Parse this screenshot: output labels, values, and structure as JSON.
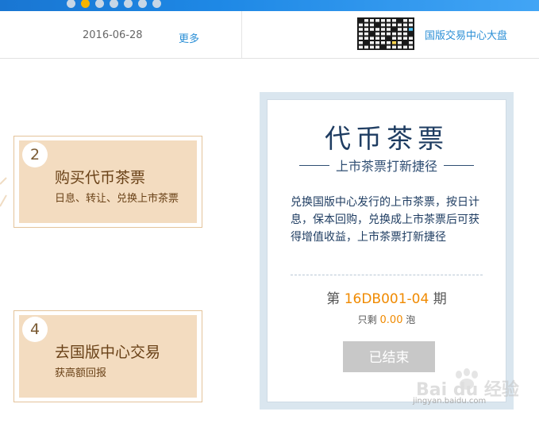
{
  "header": {
    "date": "2016-06-28",
    "more_label": "更多",
    "board_link": "国版交易中心大盘",
    "board_icon": "market-board-icon"
  },
  "carousel": {
    "dot_count": 7,
    "active_index": 1
  },
  "steps": [
    {
      "num": "2",
      "title": "购买代币茶票",
      "sub": "日息、转让、兑换上市茶票"
    },
    {
      "num": "4",
      "title": "去国版中心交易",
      "sub": "获高额回报"
    }
  ],
  "card": {
    "title": "代币茶票",
    "subtitle": "上市茶票打新捷径",
    "description": "兑换国版中心发行的上市茶票，按日计息，保本回购，兑换成上市茶票后可获得增值收益，上市茶票打新捷径",
    "period_prefix": "第",
    "period_code": "16DB001-04",
    "period_suffix": "期",
    "remain_prefix": "只剩",
    "remain_amount": "0.00",
    "remain_unit": "泡",
    "button_label": "已结束"
  },
  "watermark": {
    "logo": "Bai du 经验",
    "url": "jingyan.baidu.com"
  },
  "colors": {
    "banner": "#1e88e5",
    "accent_blue": "#2b8fd6",
    "dot_active": "#f5b400",
    "step_fill": "#f3dcc0",
    "card_navy": "#1f3d62",
    "highlight_orange": "#f08a00",
    "button_disabled": "#c8c8c8"
  }
}
